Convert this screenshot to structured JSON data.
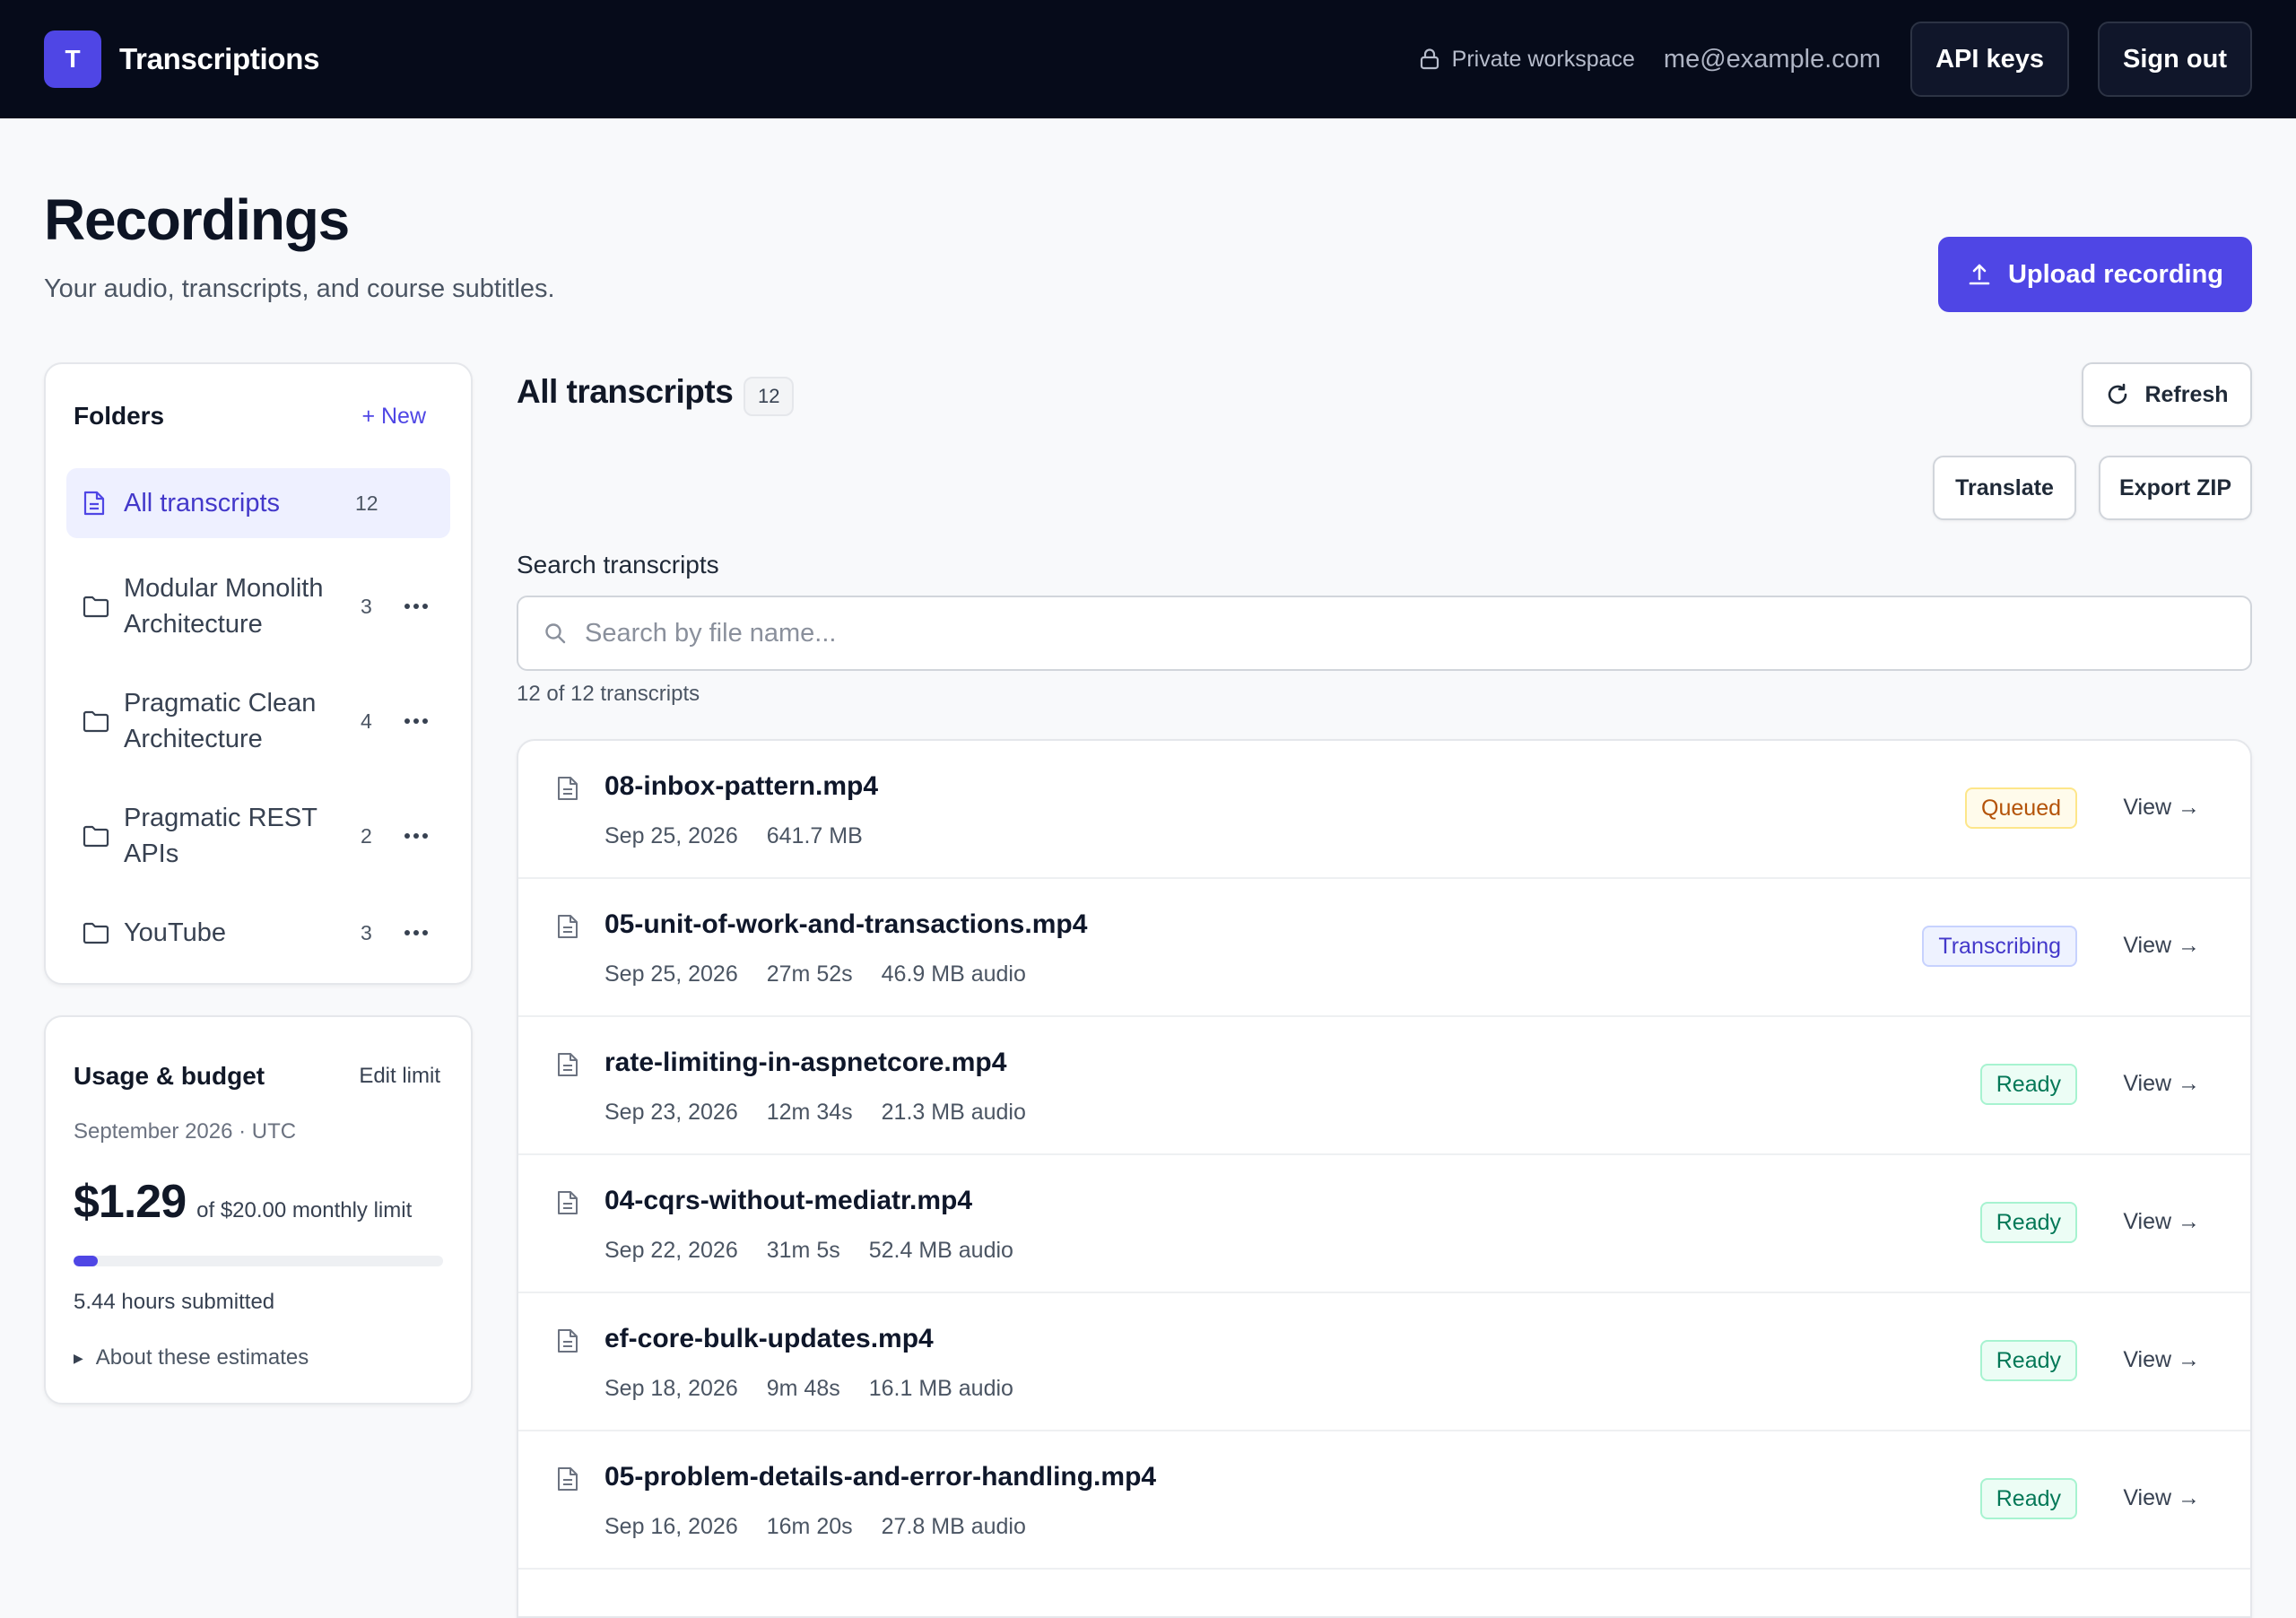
{
  "app": {
    "logo_letter": "T",
    "name": "Transcriptions"
  },
  "topbar": {
    "workspace_label": "Private workspace",
    "email": "me@example.com",
    "api_keys_label": "API keys",
    "sign_out_label": "Sign out"
  },
  "page": {
    "title": "Recordings",
    "subtitle": "Your audio, transcripts, and course subtitles.",
    "upload_label": "Upload recording"
  },
  "folders": {
    "title": "Folders",
    "new_label": "+ New",
    "items": [
      {
        "name": "All transcripts",
        "count": "12",
        "active": true
      },
      {
        "name": "Modular Monolith Architecture",
        "count": "3"
      },
      {
        "name": "Pragmatic Clean Architecture",
        "count": "4"
      },
      {
        "name": "Pragmatic REST APIs",
        "count": "2"
      },
      {
        "name": "YouTube",
        "count": "3"
      }
    ]
  },
  "usage": {
    "title": "Usage & budget",
    "edit_label": "Edit limit",
    "period": "September 2026 · UTC",
    "amount": "$1.29",
    "limit_text": "of $20.00 monthly limit",
    "used_fraction": 0.0645,
    "hours": "5.44 hours submitted",
    "about_label": "About these estimates"
  },
  "main": {
    "title": "All transcripts",
    "count": "12",
    "refresh_label": "Refresh",
    "translate_label": "Translate",
    "export_label": "Export ZIP",
    "search_label": "Search transcripts",
    "search_placeholder": "Search by file name...",
    "search_value": "",
    "results_count": "12 of 12 transcripts",
    "view_label": "View →"
  },
  "recordings": [
    {
      "name": "08-inbox-pattern.mp4",
      "date": "Sep 25, 2026",
      "duration": "",
      "size": "641.7 MB",
      "status": "Queued",
      "status_class": "queued"
    },
    {
      "name": "05-unit-of-work-and-transactions.mp4",
      "date": "Sep 25, 2026",
      "duration": "27m 52s",
      "size": "46.9 MB audio",
      "status": "Transcribing",
      "status_class": "transcribing"
    },
    {
      "name": "rate-limiting-in-aspnetcore.mp4",
      "date": "Sep 23, 2026",
      "duration": "12m 34s",
      "size": "21.3 MB audio",
      "status": "Ready",
      "status_class": "ready"
    },
    {
      "name": "04-cqrs-without-mediatr.mp4",
      "date": "Sep 22, 2026",
      "duration": "31m 5s",
      "size": "52.4 MB audio",
      "status": "Ready",
      "status_class": "ready"
    },
    {
      "name": "ef-core-bulk-updates.mp4",
      "date": "Sep 18, 2026",
      "duration": "9m 48s",
      "size": "16.1 MB audio",
      "status": "Ready",
      "status_class": "ready"
    },
    {
      "name": "05-problem-details-and-error-handling.mp4",
      "date": "Sep 16, 2026",
      "duration": "16m 20s",
      "size": "27.8 MB audio",
      "status": "Ready",
      "status_class": "ready"
    }
  ],
  "colors": {
    "accent": "#4f46e5",
    "topbar_bg": "#060b1a",
    "queued": "#b45309",
    "transcribing": "#4338ca",
    "ready": "#047857"
  }
}
